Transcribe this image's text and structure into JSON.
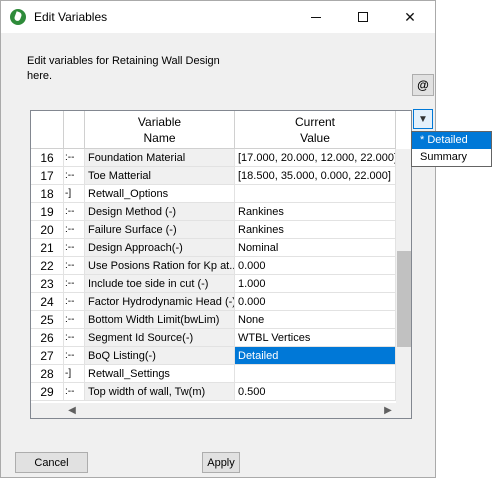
{
  "window": {
    "title": "Edit Variables",
    "description": "Edit variables for Retaining Wall Design here.",
    "at_button": "@"
  },
  "grid": {
    "headers": {
      "variable": [
        "Variable",
        "Name"
      ],
      "current": [
        "Current",
        "Value"
      ]
    },
    "rows": [
      {
        "num": "16",
        "tree": ":--",
        "name": "Foundation Material",
        "value": "[17.000, 20.000, 12.000, 22.000]",
        "group": false,
        "selected": false
      },
      {
        "num": "17",
        "tree": ":--",
        "name": "Toe Matterial",
        "value": "[18.500, 35.000, 0.000, 22.000]",
        "group": false,
        "selected": false
      },
      {
        "num": "18",
        "tree": "-]",
        "name": "Retwall_Options",
        "value": "",
        "group": true,
        "selected": false
      },
      {
        "num": "19",
        "tree": ":--",
        "name": "Design Method (-)",
        "value": "Rankines",
        "group": false,
        "selected": false
      },
      {
        "num": "20",
        "tree": ":--",
        "name": "Failure Surface (-)",
        "value": "Rankines",
        "group": false,
        "selected": false
      },
      {
        "num": "21",
        "tree": ":--",
        "name": "Design Approach(-)",
        "value": "Nominal",
        "group": false,
        "selected": false
      },
      {
        "num": "22",
        "tree": ":--",
        "name": "Use Posions Ration for Kp at...",
        "value": "0.000",
        "group": false,
        "selected": false
      },
      {
        "num": "23",
        "tree": ":--",
        "name": "Include toe side in cut (-)",
        "value": "1.000",
        "group": false,
        "selected": false
      },
      {
        "num": "24",
        "tree": ":--",
        "name": "Factor Hydrodynamic Head (-)",
        "value": "0.000",
        "group": false,
        "selected": false
      },
      {
        "num": "25",
        "tree": ":--",
        "name": "Bottom Width Limit(bwLim)",
        "value": "None",
        "group": false,
        "selected": false
      },
      {
        "num": "26",
        "tree": ":--",
        "name": "Segment Id Source(-)",
        "value": "WTBL Vertices",
        "group": false,
        "selected": false
      },
      {
        "num": "27",
        "tree": ":--",
        "name": "BoQ Listing(-)",
        "value": "Detailed",
        "group": false,
        "selected": true
      },
      {
        "num": "28",
        "tree": "-]",
        "name": "Retwall_Settings",
        "value": "",
        "group": true,
        "selected": false
      },
      {
        "num": "29",
        "tree": ":--",
        "name": "Top width of wall, Tw(m)",
        "value": "0.500",
        "group": false,
        "selected": false
      }
    ]
  },
  "dropdown": {
    "options": [
      "* Detailed",
      "Summary"
    ],
    "selected_index": 0
  },
  "buttons": {
    "cancel": "Cancel",
    "apply": "Apply"
  },
  "colors": {
    "selection": "#0078d7",
    "window_bg": "#f0f0f0"
  }
}
